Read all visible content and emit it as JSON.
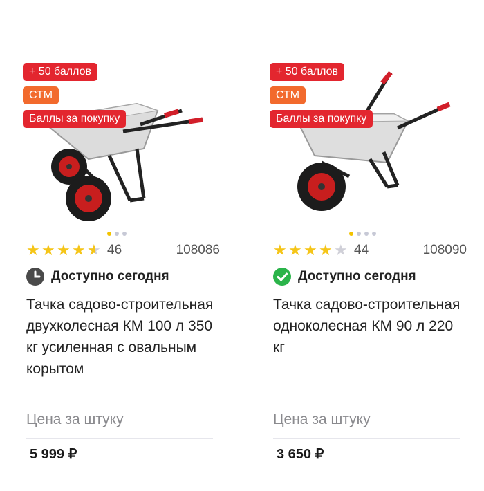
{
  "products": [
    {
      "badges": {
        "points": "+ 50 баллов",
        "stm": "СТМ",
        "bonus": "Баллы за покупку"
      },
      "rating": 4.5,
      "reviews": "46",
      "sku": "108086",
      "availability": {
        "text": "Доступно сегодня",
        "icon": "clock-icon"
      },
      "title": "Тачка садово-строительная двухколесная КМ 100 л 350 кг усиленная с овальным корытом",
      "price_label": "Цена за штуку",
      "price": "5 999 ₽"
    },
    {
      "badges": {
        "points": "+ 50 баллов",
        "stm": "СТМ",
        "bonus": "Баллы за покупку"
      },
      "rating": 4,
      "reviews": "44",
      "sku": "108090",
      "availability": {
        "text": "Доступно сегодня",
        "icon": "check-circle-icon"
      },
      "title": "Тачка садово-строительная одноколесная КМ 90 л 220 кг",
      "price_label": "Цена за штуку",
      "price": "3 650 ₽"
    }
  ],
  "colors": {
    "badge_red": "#e3262f",
    "badge_orange": "#f26a2d",
    "star": "#f5c518",
    "available_green": "#2bb44a"
  }
}
